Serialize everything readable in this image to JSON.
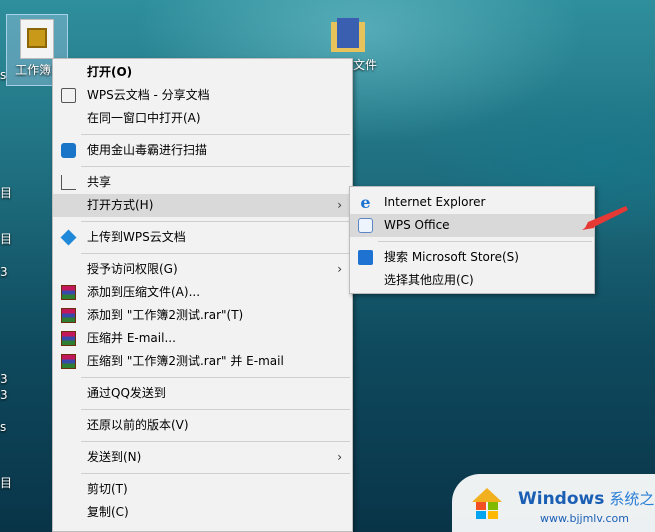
{
  "desktop": {
    "selected_icon_label": "工作簿2",
    "folder_icon_label": "文件",
    "left_fragments": [
      "s",
      "目",
      "目",
      "3",
      "3",
      "3",
      "s",
      "目"
    ]
  },
  "context_menu": {
    "items": [
      {
        "label": "打开(O)",
        "bold": true,
        "icon": ""
      },
      {
        "label": "WPS云文档 - 分享文档",
        "icon": "wps-cloud-icon"
      },
      {
        "label": "在同一窗口中打开(A)",
        "icon": ""
      },
      {
        "label": "使用金山毒霸进行扫描",
        "icon": "duba-icon"
      },
      {
        "label": "共享",
        "icon": "share-icon"
      },
      {
        "label": "打开方式(H)",
        "icon": "",
        "submenu": true
      },
      {
        "label": "上传到WPS云文档",
        "icon": "cube-icon"
      },
      {
        "label": "授予访问权限(G)",
        "icon": "",
        "submenu": true
      },
      {
        "label": "添加到压缩文件(A)...",
        "icon": "winrar-icon"
      },
      {
        "label": "添加到 \"工作簿2测试.rar\"(T)",
        "icon": "winrar-icon"
      },
      {
        "label": "压缩并 E-mail...",
        "icon": "winrar-icon"
      },
      {
        "label": "压缩到 \"工作簿2测试.rar\" 并 E-mail",
        "icon": "winrar-icon"
      },
      {
        "label": "通过QQ发送到",
        "icon": ""
      },
      {
        "label": "还原以前的版本(V)",
        "icon": ""
      },
      {
        "label": "发送到(N)",
        "icon": "",
        "submenu": true
      },
      {
        "label": "剪切(T)",
        "icon": ""
      },
      {
        "label": "复制(C)",
        "icon": ""
      }
    ],
    "submenu_arrow": "›"
  },
  "open_with_submenu": {
    "items": [
      {
        "label": "Internet Explorer",
        "icon": "ie-icon"
      },
      {
        "label": "WPS Office",
        "icon": "wps-office-icon"
      },
      {
        "label": "搜索 Microsoft Store(S)",
        "icon": "store-icon"
      },
      {
        "label": "选择其他应用(C)",
        "icon": ""
      }
    ]
  },
  "watermark": {
    "brand": "Windows",
    "brand_cn": "系统之家",
    "url": "www.bjjmlv.com"
  },
  "colors": {
    "menu_bg": "#f2f2f2",
    "hover_bg": "#d9d9d9",
    "arrow_red": "#e53935",
    "brand_blue": "#1b5fb5"
  }
}
